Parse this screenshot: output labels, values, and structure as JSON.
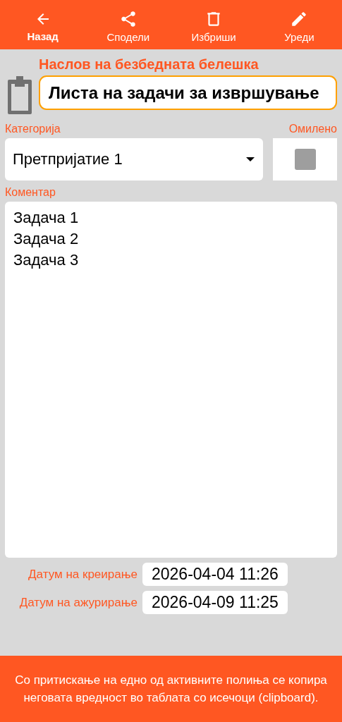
{
  "toolbar": [
    {
      "kind": "back",
      "label": "Назад",
      "emphasized": true
    },
    {
      "kind": "share",
      "label": "Сподели",
      "emphasized": false
    },
    {
      "kind": "delete",
      "label": "Избриши",
      "emphasized": false
    },
    {
      "kind": "edit",
      "label": "Уреди",
      "emphasized": false
    }
  ],
  "title": {
    "label": "Наслов на безбедната белешка",
    "value": "Листа на задачи за извршување"
  },
  "category": {
    "label": "Категорија",
    "value": "Претпријатие 1"
  },
  "favorite": {
    "label": "Омилено",
    "checked": false
  },
  "comment": {
    "label": "Коментар",
    "value": "Задача 1\nЗадача 2\nЗадача 3"
  },
  "dates": [
    {
      "label": "Датум на креирање",
      "value": "2026-04-04 11:26"
    },
    {
      "label": "Датум на ажурирање",
      "value": "2026-04-09 11:25"
    }
  ],
  "footer": "Со притискање на едно од активните полиња се копира неговата вредност во таблата со исечоци (clipboard)."
}
